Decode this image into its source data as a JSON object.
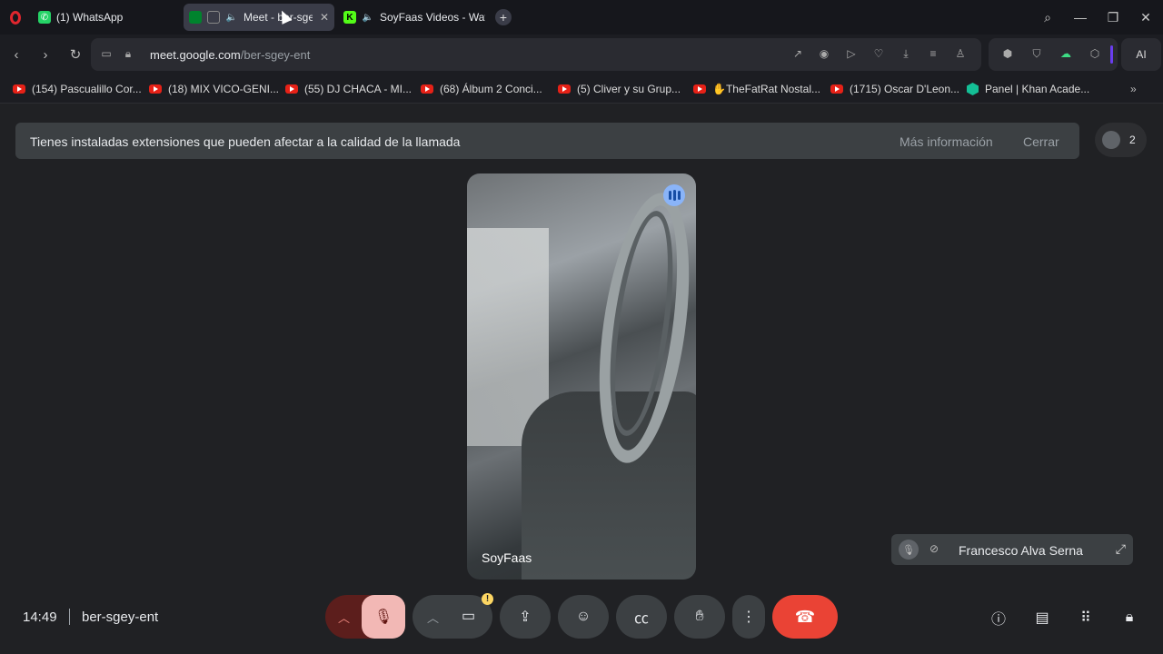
{
  "browser": {
    "tabs": [
      {
        "label": "(1) WhatsApp",
        "icon": "whatsapp-icon"
      },
      {
        "label": "Meet - ber-sge",
        "icon": "google-meet-icon",
        "active": true
      },
      {
        "label": "SoyFaas Videos - Watc",
        "icon": "kick-icon"
      }
    ],
    "url_domain": "meet.google.com",
    "url_path": "/ber-sgey-ent",
    "ai_label": "AI",
    "bookmarks": [
      {
        "label": "(154) Pascualillo Cor...",
        "icon": "youtube-icon"
      },
      {
        "label": "(18) MIX VICO-GENI...",
        "icon": "youtube-icon"
      },
      {
        "label": "(55) DJ CHACA - MI...",
        "icon": "youtube-icon"
      },
      {
        "label": "(68) Álbum 2 Conci...",
        "icon": "youtube-icon"
      },
      {
        "label": "(5) Cliver y su Grup...",
        "icon": "youtube-icon"
      },
      {
        "label": "✋TheFatRat Nostal...",
        "icon": "youtube-icon"
      },
      {
        "label": "(1715) Oscar D'Leon...",
        "icon": "youtube-icon"
      },
      {
        "label": "Panel | Khan Acade...",
        "icon": "khan-icon"
      }
    ]
  },
  "meet": {
    "banner_text": "Tienes instaladas extensiones que pueden afectar a la calidad de la llamada",
    "banner_more": "Más información",
    "banner_close": "Cerrar",
    "participant_count": "2",
    "main_participant": "SoyFaas",
    "self_name": "Francesco Alva Serna",
    "clock": "14:49",
    "meeting_code": "ber-sgey-ent",
    "warning_badge": "!"
  },
  "colors": {
    "hangup": "#ea4335",
    "mic_off_bg": "#f2b8b5",
    "speaking": "#8ab4f8",
    "banner_bg": "#3c4043"
  }
}
